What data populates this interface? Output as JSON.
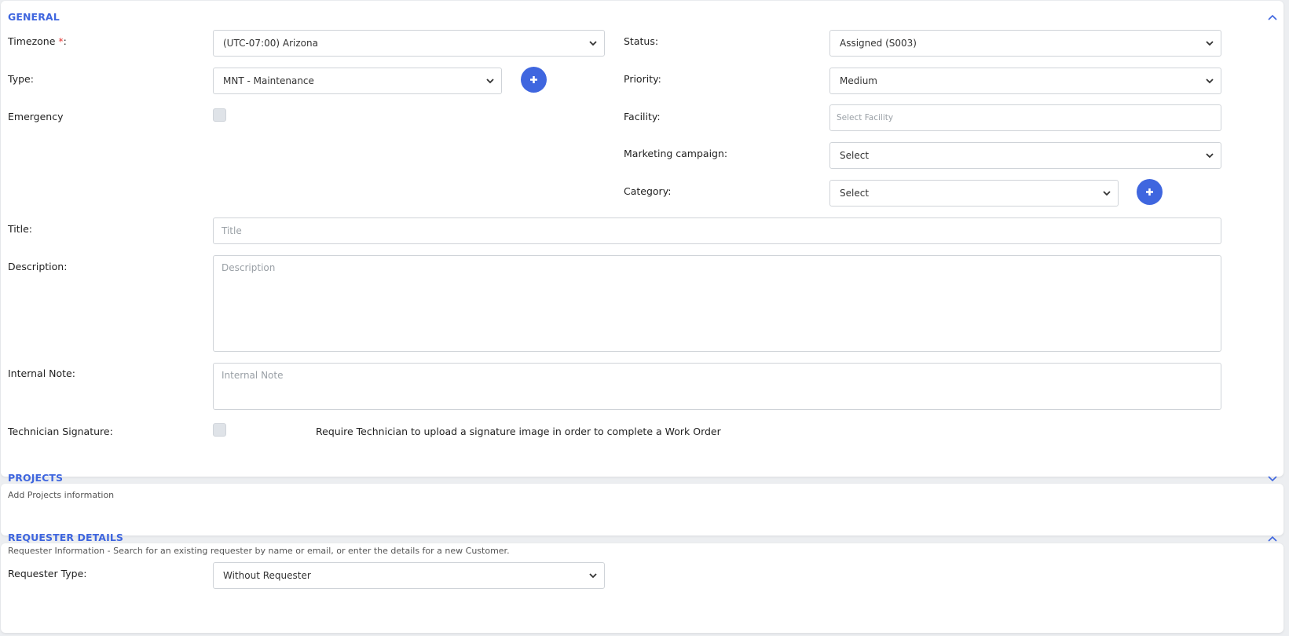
{
  "colors": {
    "accent": "#3f66df",
    "required": "#e53935",
    "muted_text": "#555555"
  },
  "general": {
    "title": "GENERAL",
    "collapse_icon": "chevron-up-icon",
    "timezone": {
      "label": "Timezone ",
      "required_mark": "*",
      "label_suffix": ":",
      "value": "(UTC-07:00) Arizona"
    },
    "status": {
      "label": "Status:",
      "value": "Assigned (S003)"
    },
    "type": {
      "label": "Type:",
      "value": "MNT - Maintenance",
      "add_icon": "plus-icon"
    },
    "priority": {
      "label": "Priority:",
      "value": "Medium"
    },
    "emergency": {
      "label": "Emergency",
      "checked": false
    },
    "facility": {
      "label": "Facility:",
      "placeholder": "Select Facility"
    },
    "marketing_campaign": {
      "label": "Marketing campaign:",
      "value": "Select"
    },
    "category": {
      "label": "Category:",
      "value": "Select",
      "add_icon": "plus-icon"
    },
    "title_field": {
      "label": "Title:",
      "placeholder": "Title"
    },
    "description": {
      "label": "Description:",
      "placeholder": "Description"
    },
    "internal_note": {
      "label": "Internal Note:",
      "placeholder": "Internal Note"
    },
    "technician_signature": {
      "label": "Technician Signature:",
      "checked": false,
      "help": "Require Technician to upload a signature image in order to complete a Work Order"
    }
  },
  "projects": {
    "title": "PROJECTS",
    "subtitle": "Add Projects information",
    "expand_icon": "chevron-down-icon"
  },
  "requester": {
    "title": "REQUESTER DETAILS",
    "subtitle": "Requester Information - Search for an existing requester by name or email, or enter the details for a new Customer.",
    "collapse_icon": "chevron-up-icon",
    "requester_type": {
      "label": "Requester Type:",
      "value": "Without Requester"
    }
  }
}
